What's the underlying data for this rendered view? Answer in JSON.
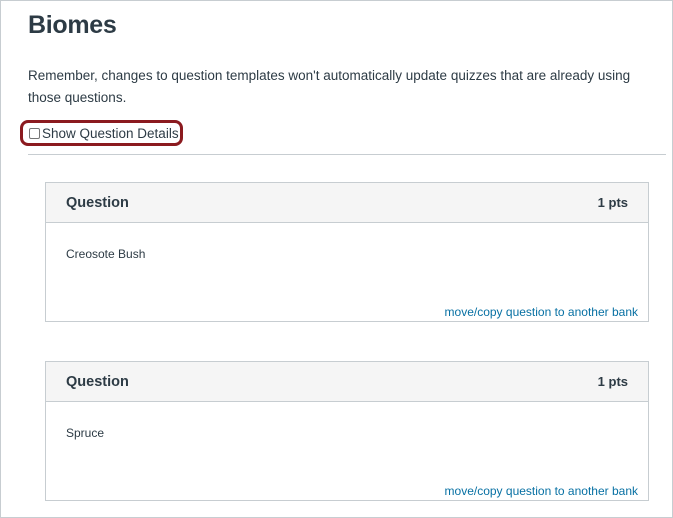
{
  "page": {
    "title": "Biomes",
    "notice": "Remember, changes to question templates won't automatically update quizzes that are already using those questions."
  },
  "details_toggle": {
    "label": "Show Question Details",
    "checked": false
  },
  "questions": [
    {
      "title": "Question",
      "points": "1 pts",
      "text": "Creosote Bush",
      "link": "move/copy question to another bank"
    },
    {
      "title": "Question",
      "points": "1 pts",
      "text": "Spruce",
      "link": "move/copy question to another bank"
    }
  ],
  "colors": {
    "text": "#2d3b45",
    "link": "#0770a3",
    "highlight_border": "#8b1a1f",
    "header_bg": "#f5f5f5",
    "border": "#c7cdd1"
  }
}
